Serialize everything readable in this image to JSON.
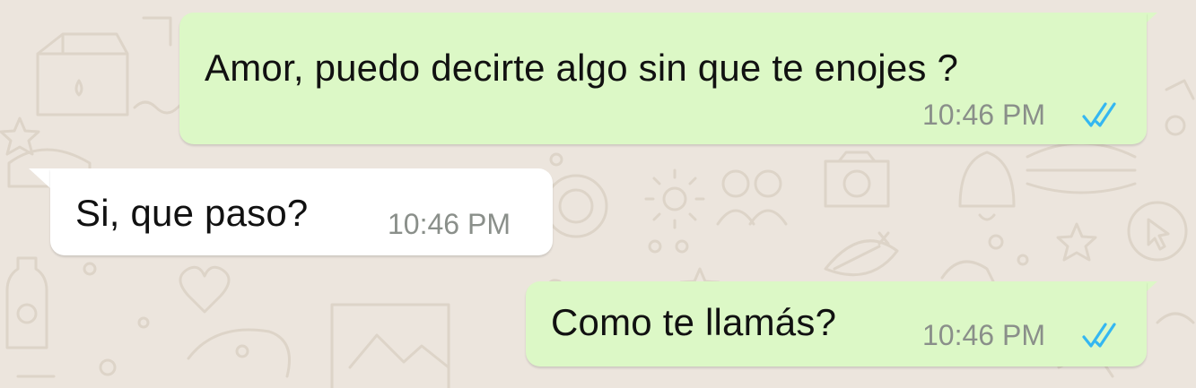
{
  "chat": {
    "messages": [
      {
        "direction": "outgoing",
        "text": "Amor, puedo decirte algo sin que te enojes ?",
        "time": "10:46 PM",
        "status": "read"
      },
      {
        "direction": "incoming",
        "text": "Si, que paso?",
        "time": "10:46 PM"
      },
      {
        "direction": "outgoing",
        "text": "Como te llamás?",
        "time": "10:46 PM",
        "status": "read"
      }
    ]
  },
  "colors": {
    "background": "#ece5dd",
    "outgoing_bubble": "#dcf8c6",
    "incoming_bubble": "#ffffff",
    "read_ticks": "#34b7f1",
    "timestamp": "#8a8f8a"
  },
  "icons": {
    "read_receipt": "double-check-icon",
    "wallpaper": "doodle-pattern"
  }
}
